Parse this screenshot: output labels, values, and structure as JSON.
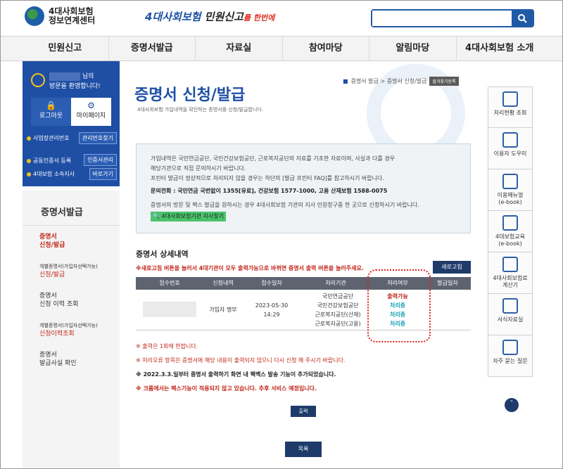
{
  "header": {
    "logo_line1": "4대사회보험",
    "logo_line2": "정보연계센터",
    "slogan_blue": "4대사회보험",
    "slogan_black": " 민원신고",
    "slogan_red": "를 한번에",
    "search_placeholder": ""
  },
  "nav": [
    "민원신고",
    "증명서발급",
    "자료실",
    "참여마당",
    "알림마당",
    "4대사회보험 소개"
  ],
  "login": {
    "greeting_suffix": "님의",
    "welcome": "방문을 환영합니다!",
    "logout": "로그아웃",
    "mypage": "마이페이지",
    "link1": "사업장관리번호",
    "btn1": "관리번호찾기",
    "link2": "공동인증서 등록",
    "btn2": "인증서관리",
    "link3": "4대보험 소속지사",
    "btn3": "바로가기"
  },
  "left_menu": {
    "title": "증명서발급",
    "items": [
      {
        "l1": "증명서",
        "l2": "신청/발급"
      },
      {
        "l1": "개별증명서(가입자선택가능)",
        "l2": "신청/발급"
      },
      {
        "l1": "증명서",
        "l2": "신청 이력 조회"
      },
      {
        "l1": "개별증명서(가입자선택가능)",
        "l2": "신청이력조회"
      },
      {
        "l1": "증명서",
        "l2": "발급사실 확인"
      }
    ]
  },
  "page": {
    "title": "증명서 신청/발급",
    "subtitle": "4대사회보험 가입내역을 확인하는 증명서를 신청/발급합니다.",
    "breadcrumb": "증명서 발급 > 증명서 신청/발급",
    "favorite": "즐겨찾기등록"
  },
  "notice": {
    "p1": "가입내역은 국민연금공단, 국민건강보험공단, 근로복지공단의 자료를 기초한 자료이며, 사실과 다를 경우",
    "p1b": "해당기관으로 직접 문의하시기 바랍니다.",
    "p2": "프린터 발급이 정상적으로 처리되지 않을 경우는 하단의 [발급 프린터 FAQ]를 참고하시기 바랍니다.",
    "phone": "문의전화 : 국민연금 국번없이 1355[유료], 건강보험 1577-1000, 고용 산재보험 1588-0075",
    "p3": "증명서의 방문 및 팩스 발급을 원하시는 경우 4대사회보험 기관의 지사 민원창구중 한 곳으로 신청하시기 바랍니다.",
    "find": "4대사회보험기관 지사찾기"
  },
  "detail": {
    "title": "증명서 상세내역",
    "red_note": "※새로고침 버튼을 눌러서 4대기관이 모두 출력가능으로 바뀌면 증명서 출력 버튼을 눌러주세요.",
    "refresh": "새로고침",
    "headers": [
      "접수번호",
      "신청내역",
      "접수일자",
      "처리기관",
      "처리여부",
      "발급일자"
    ],
    "row": {
      "type": "가입자 명부",
      "date": "2023-05-30",
      "time": "14:29",
      "agencies": [
        "국민연금공단",
        "국민건강보험공단",
        "근로복지공단(산재)",
        "근로복지공단(고용)"
      ],
      "statuses": [
        "출력가능",
        "처리중",
        "처리중",
        "처리중"
      ]
    }
  },
  "notes": {
    "n1": "※ 출력은 1회에 한합니다.",
    "n2": "※ 처리오류 항목은 증명서에 해당 내용이 출력되지 않으니 다시 신청 해 주시기 바랍니다.",
    "n3": "※ 2022.3.3.일부터 증명서 출력하기 화면 내 팩백스 발송 기능이 추가되었습니다.",
    "n4": "※ 크롬에서는 팩스기능이 적용되지 않고 있습니다. 추후 서비스 예정입니다."
  },
  "buttons": {
    "print": "출력",
    "list": "목록"
  },
  "quick": [
    "처리현황 조회",
    "이용자 도우미",
    "이용메뉴얼\n(e-book)",
    "4대보험교육\n(e-book)",
    "4대사회보험료\n계산기",
    "서식자료실",
    "자주 묻는 질문"
  ]
}
